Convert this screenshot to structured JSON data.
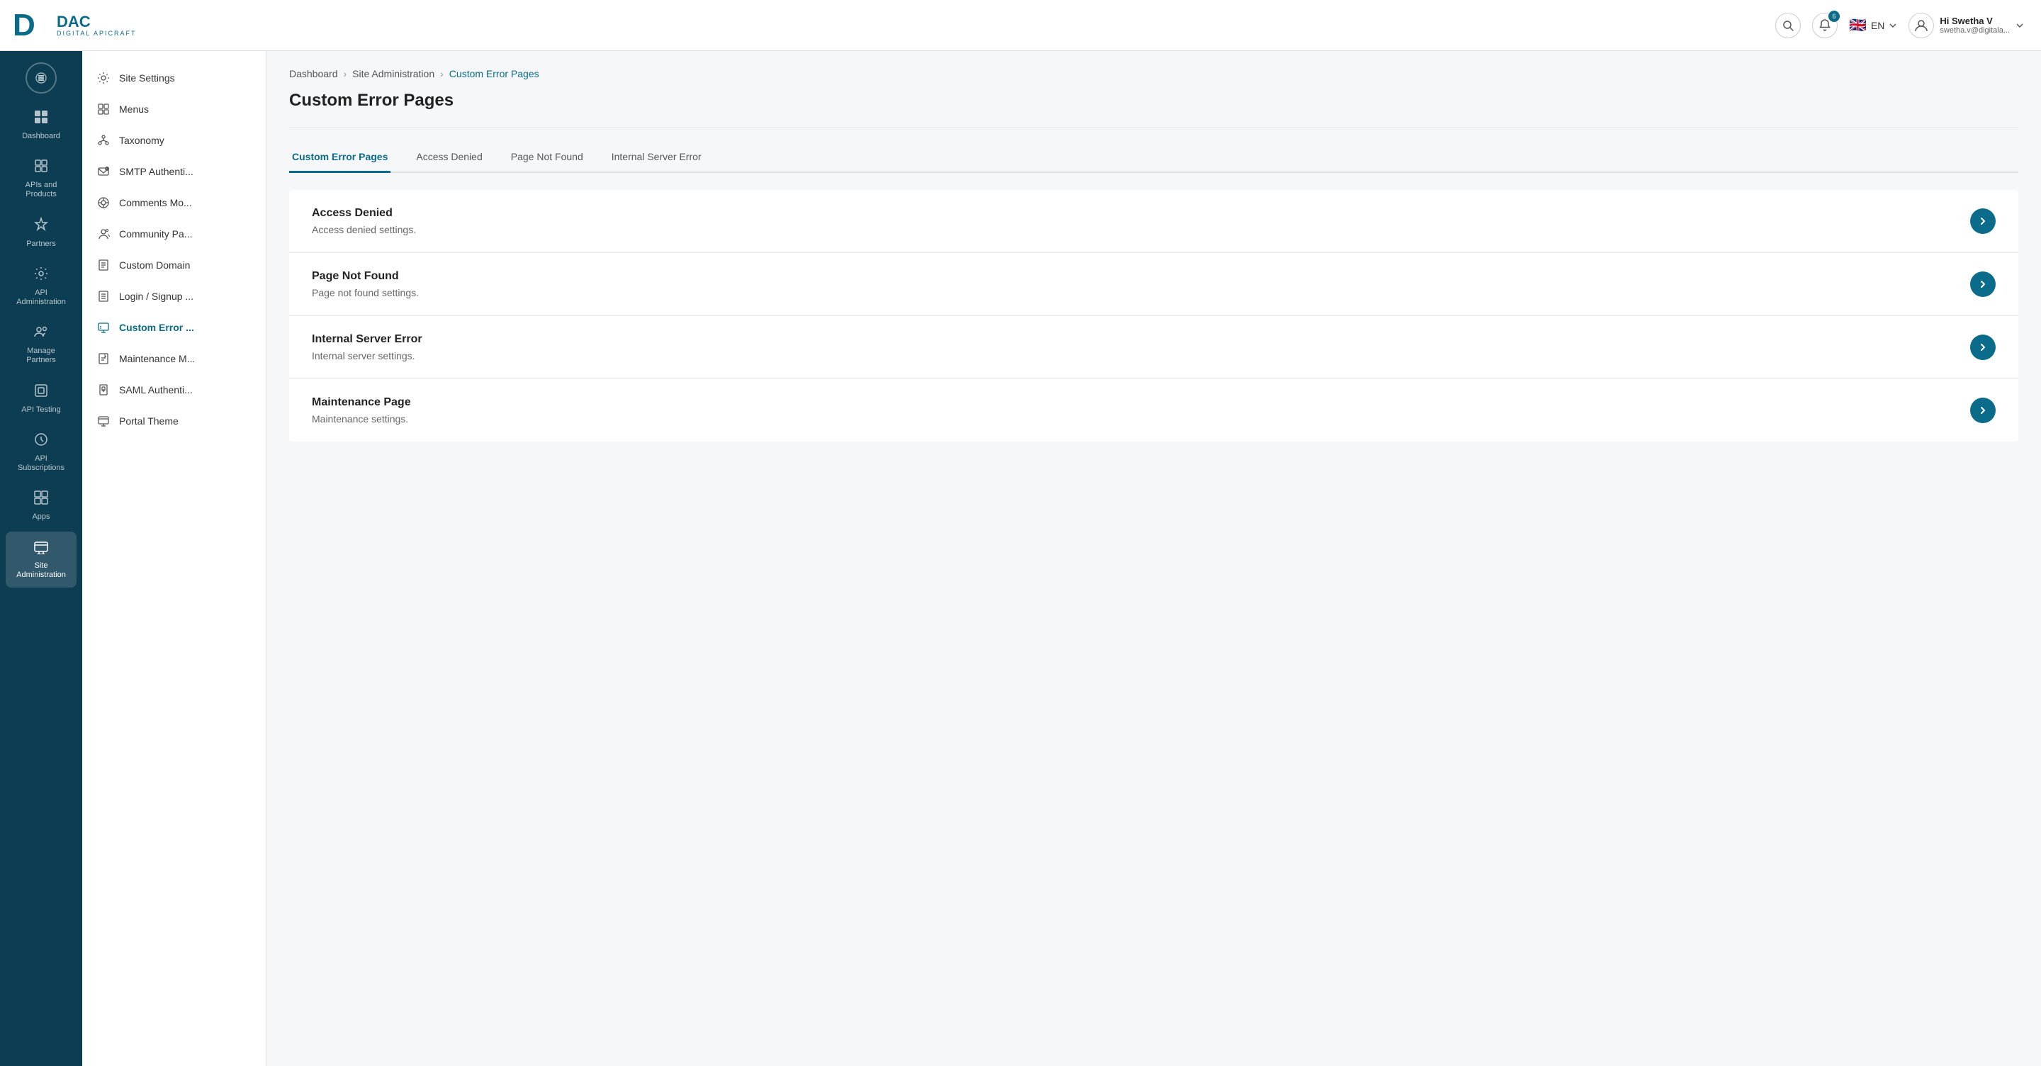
{
  "header": {
    "logo_d": "DAC",
    "logo_sub": "DIGITAL APICRAFT",
    "search_title": "Search",
    "notif_count": "6",
    "lang": "EN",
    "user_name": "Hi Swetha V",
    "user_email": "swetha.v@digitala..."
  },
  "left_nav": {
    "items": [
      {
        "id": "dashboard",
        "label": "Dashboard",
        "icon": "⊞"
      },
      {
        "id": "apis",
        "label": "APIs and Products",
        "icon": "⬡"
      },
      {
        "id": "partners",
        "label": "Partners",
        "icon": "✦"
      },
      {
        "id": "api-admin",
        "label": "API Administration",
        "icon": "⚙"
      },
      {
        "id": "manage-partners",
        "label": "Manage Partners",
        "icon": "👥"
      },
      {
        "id": "api-testing",
        "label": "API Testing",
        "icon": "⧉"
      },
      {
        "id": "api-subscriptions",
        "label": "API Subscriptions",
        "icon": "⊕"
      },
      {
        "id": "apps",
        "label": "Apps",
        "icon": "▦"
      },
      {
        "id": "site-admin",
        "label": "Site Administration",
        "icon": "🖥"
      }
    ]
  },
  "secondary_nav": {
    "items": [
      {
        "id": "site-settings",
        "label": "Site Settings",
        "icon": "gear"
      },
      {
        "id": "menus",
        "label": "Menus",
        "icon": "grid"
      },
      {
        "id": "taxonomy",
        "label": "Taxonomy",
        "icon": "tree"
      },
      {
        "id": "smtp",
        "label": "SMTP Authenti...",
        "icon": "email"
      },
      {
        "id": "comments",
        "label": "Comments Mo...",
        "icon": "settings-eye"
      },
      {
        "id": "community",
        "label": "Community Pa...",
        "icon": "person-settings"
      },
      {
        "id": "custom-domain",
        "label": "Custom Domain",
        "icon": "doc"
      },
      {
        "id": "login-signup",
        "label": "Login / Signup ...",
        "icon": "doc-lines"
      },
      {
        "id": "custom-error",
        "label": "Custom Error ...",
        "icon": "monitor"
      },
      {
        "id": "maintenance",
        "label": "Maintenance M...",
        "icon": "wrench-doc"
      },
      {
        "id": "saml",
        "label": "SAML Authenti...",
        "icon": "lock-doc"
      },
      {
        "id": "portal-theme",
        "label": "Portal Theme",
        "icon": "monitor-settings"
      }
    ]
  },
  "breadcrumb": {
    "items": [
      {
        "label": "Dashboard",
        "link": true
      },
      {
        "label": "Site Administration",
        "link": true
      },
      {
        "label": "Custom Error Pages",
        "active": true
      }
    ]
  },
  "page": {
    "title": "Custom Error Pages",
    "tabs": [
      {
        "id": "custom-error-pages",
        "label": "Custom Error Pages",
        "active": true
      },
      {
        "id": "access-denied",
        "label": "Access Denied"
      },
      {
        "id": "page-not-found",
        "label": "Page Not Found"
      },
      {
        "id": "internal-server-error",
        "label": "Internal Server Error"
      }
    ],
    "cards": [
      {
        "id": "access-denied",
        "title": "Access Denied",
        "desc": "Access denied settings."
      },
      {
        "id": "page-not-found",
        "title": "Page Not Found",
        "desc": "Page not found settings."
      },
      {
        "id": "internal-server-error",
        "title": "Internal Server Error",
        "desc": "Internal server settings."
      },
      {
        "id": "maintenance-page",
        "title": "Maintenance Page",
        "desc": "Maintenance settings."
      }
    ]
  }
}
